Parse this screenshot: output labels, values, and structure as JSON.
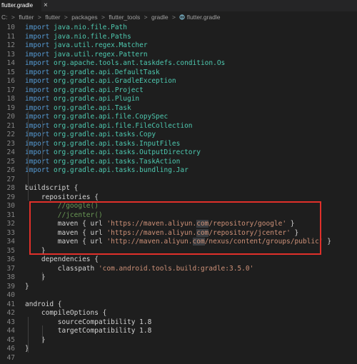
{
  "tab": {
    "filename": "flutter.gradle",
    "close": "×"
  },
  "breadcrumb": {
    "folder_glyph": "C:",
    "items": [
      "flutter",
      "flutter",
      "packages",
      "flutter_tools",
      "gradle",
      "flutter.gradle"
    ],
    "separator": ">"
  },
  "lines": [
    {
      "n": "10",
      "segs": [
        [
          "kw",
          "import "
        ],
        [
          "ty",
          "java.nio.file.Path"
        ]
      ]
    },
    {
      "n": "11",
      "segs": [
        [
          "kw",
          "import "
        ],
        [
          "ty",
          "java.nio.file.Paths"
        ]
      ]
    },
    {
      "n": "12",
      "segs": [
        [
          "kw",
          "import "
        ],
        [
          "ty",
          "java.util.regex.Matcher"
        ]
      ]
    },
    {
      "n": "13",
      "segs": [
        [
          "kw",
          "import "
        ],
        [
          "ty",
          "java.util.regex.Pattern"
        ]
      ]
    },
    {
      "n": "14",
      "segs": [
        [
          "kw",
          "import "
        ],
        [
          "ty",
          "org.apache.tools.ant.taskdefs.condition.Os"
        ]
      ]
    },
    {
      "n": "15",
      "segs": [
        [
          "kw",
          "import "
        ],
        [
          "ty",
          "org.gradle.api.DefaultTask"
        ]
      ]
    },
    {
      "n": "16",
      "segs": [
        [
          "kw",
          "import "
        ],
        [
          "ty",
          "org.gradle.api.GradleException"
        ]
      ]
    },
    {
      "n": "17",
      "segs": [
        [
          "kw",
          "import "
        ],
        [
          "ty",
          "org.gradle.api.Project"
        ]
      ]
    },
    {
      "n": "18",
      "segs": [
        [
          "kw",
          "import "
        ],
        [
          "ty",
          "org.gradle.api.Plugin"
        ]
      ]
    },
    {
      "n": "19",
      "segs": [
        [
          "kw",
          "import "
        ],
        [
          "ty",
          "org.gradle.api.Task"
        ]
      ]
    },
    {
      "n": "20",
      "segs": [
        [
          "kw",
          "import "
        ],
        [
          "ty",
          "org.gradle.api.file.CopySpec"
        ]
      ]
    },
    {
      "n": "21",
      "segs": [
        [
          "kw",
          "import "
        ],
        [
          "ty",
          "org.gradle.api.file.FileCollection"
        ]
      ]
    },
    {
      "n": "22",
      "segs": [
        [
          "kw",
          "import "
        ],
        [
          "ty",
          "org.gradle.api.tasks.Copy"
        ]
      ]
    },
    {
      "n": "23",
      "segs": [
        [
          "kw",
          "import "
        ],
        [
          "ty",
          "org.gradle.api.tasks.InputFiles"
        ]
      ]
    },
    {
      "n": "24",
      "segs": [
        [
          "kw",
          "import "
        ],
        [
          "ty",
          "org.gradle.api.tasks.OutputDirectory"
        ]
      ]
    },
    {
      "n": "25",
      "segs": [
        [
          "kw",
          "import "
        ],
        [
          "ty",
          "org.gradle.api.tasks.TaskAction"
        ]
      ]
    },
    {
      "n": "26",
      "segs": [
        [
          "kw",
          "import "
        ],
        [
          "ty",
          "org.gradle.api.tasks.bundling.Jar"
        ]
      ]
    },
    {
      "n": "27",
      "segs": []
    },
    {
      "n": "28",
      "segs": [
        [
          "",
          "buildscript {"
        ]
      ]
    },
    {
      "n": "29",
      "segs": [
        [
          "",
          "    repositories {"
        ]
      ]
    },
    {
      "n": "30",
      "segs": [
        [
          "cm",
          "        //google()"
        ]
      ]
    },
    {
      "n": "31",
      "segs": [
        [
          "cm",
          "        //jcenter()"
        ]
      ]
    },
    {
      "n": "32",
      "segs": [
        [
          "",
          "        maven { url "
        ],
        [
          "str",
          "'https://maven.aliyun."
        ],
        [
          "str hl",
          "com"
        ],
        [
          "str",
          "/repository/google'"
        ],
        [
          "",
          " }"
        ]
      ]
    },
    {
      "n": "33",
      "segs": [
        [
          "",
          "        maven { url "
        ],
        [
          "str",
          "'https://maven.aliyun."
        ],
        [
          "str hl",
          "com"
        ],
        [
          "str",
          "/repository/jcenter'"
        ],
        [
          "",
          " }"
        ]
      ]
    },
    {
      "n": "34",
      "segs": [
        [
          "",
          "        maven { url "
        ],
        [
          "str",
          "'http://maven.aliyun."
        ],
        [
          "str hl",
          "com"
        ],
        [
          "str",
          "/nexus/content/groups/public'"
        ],
        [
          "",
          " }"
        ]
      ]
    },
    {
      "n": "35",
      "segs": [
        [
          "",
          "    }"
        ]
      ]
    },
    {
      "n": "36",
      "segs": [
        [
          "",
          "    dependencies {"
        ]
      ]
    },
    {
      "n": "37",
      "segs": [
        [
          "",
          "        classpath "
        ],
        [
          "str",
          "'com.android.tools.build:gradle:3.5.0'"
        ]
      ]
    },
    {
      "n": "38",
      "segs": [
        [
          "",
          "    }"
        ]
      ]
    },
    {
      "n": "39",
      "segs": [
        [
          "",
          "}"
        ]
      ]
    },
    {
      "n": "40",
      "segs": []
    },
    {
      "n": "41",
      "segs": [
        [
          "",
          "android {"
        ]
      ]
    },
    {
      "n": "42",
      "segs": [
        [
          "",
          "    compileOptions {"
        ]
      ]
    },
    {
      "n": "43",
      "segs": [
        [
          "",
          "        sourceCompatibility 1.8"
        ]
      ]
    },
    {
      "n": "44",
      "segs": [
        [
          "",
          "        targetCompatibility 1.8"
        ]
      ]
    },
    {
      "n": "45",
      "segs": [
        [
          "",
          "    }"
        ]
      ]
    },
    {
      "n": "46",
      "segs": [
        [
          "",
          "}"
        ]
      ]
    },
    {
      "n": "47",
      "segs": []
    }
  ],
  "colors": {
    "keyword": "#569cd6",
    "type": "#4ec9b0",
    "string": "#ce9178",
    "comment": "#6a9955",
    "annotation_box": "#e0302a"
  }
}
